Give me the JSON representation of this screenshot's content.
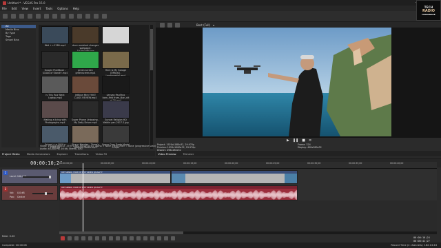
{
  "window": {
    "title": "Untitled * - VEGAS Pro 15.0"
  },
  "menu": [
    "File",
    "Edit",
    "View",
    "Insert",
    "Tools",
    "Options",
    "Help"
  ],
  "logo": {
    "line1": "TECH",
    "line2": "RADIO",
    "line3": "HARDWARE"
  },
  "explorer": {
    "tree": [
      "All",
      "Media Bins",
      "By Type",
      "Tags",
      "Smart Bins"
    ],
    "selected_index": 0,
    "thumbnails": [
      {
        "caption": "8bit + r-1280.mp4",
        "color": "#3a4a5a"
      },
      {
        "caption": "drum ambient changes wallpaper-1920x1080.jpg",
        "color": "#4a3a2a"
      },
      {
        "caption": "",
        "color": "#d6d6d6"
      },
      {
        "caption": "Google PixelBook - $1000 of Stand!!.mp4",
        "color": "#2a2a2a"
      },
      {
        "caption": "green screen greenscreen.mp4",
        "color": "#2fa84a"
      },
      {
        "caption": "Here Is My Garage (Official) - Lamborghini.mp4",
        "color": "#7a6a4a"
      },
      {
        "caption": "Is This Your Next Laptop.mp4",
        "color": "#5a5a5a"
      },
      {
        "caption": "JetBlue Mint FIRST CLASS REVIEW.mp4",
        "color": "#6a4a3a"
      },
      {
        "caption": "Lenyan PaulTrax born_first from_illan_nit of 30.mp4",
        "color": "#1a1a1a"
      },
      {
        "caption": "Making a living with Photographs.mp4",
        "color": "#5a4a4a"
      },
      {
        "caption": "Super Phone Unboxing - My Daily Driver.mp4",
        "color": "#2a2a2a"
      },
      {
        "caption": "Sunset Religion HD Walkie pan-2017-2.jpg",
        "color": "#3a3a4a"
      },
      {
        "caption": "School + a 1920 a 1080.jpg",
        "color": "#4a5a6a"
      },
      {
        "caption": "Shaun Mendes - There's Nothing Holdin.mp4",
        "color": "#7a6a5a"
      },
      {
        "caption": "Space Gray Trade Model S.mp4",
        "color": "#3a3a3a"
      }
    ],
    "info_lines": [
      "Video: 1920x1080x32, 29.970 fps, 00:00:31;01, Alpha = None, Field Order = None (progressive scan)",
      "Audio: 48,000 Hz, 16 bit, Stereo, AAC"
    ],
    "tabs": [
      "Project Media",
      "Media Generators",
      "Explorer",
      "Transitions",
      "Video FX"
    ]
  },
  "preview": {
    "quality": "Best (Full)",
    "stats_left": [
      "Project:  1920x1080x32, 29.970p",
      "Preview:  1920x1080x32, 29.970p",
      "Display:  498x280x32"
    ],
    "stats_right": [
      "Frame:  324",
      "Display:  498x280x32"
    ],
    "tabs": [
      "Video Preview",
      "Trimmer"
    ]
  },
  "timeline": {
    "timecode": "00:00:10;24",
    "ruler_labels": [
      "00:00:00;00",
      "00:00:05;00",
      "00:00:10;00",
      "00:00:15;00",
      "00:00:20;00",
      "00:00:25;00",
      "00:00:30;00",
      "00:00:35;00",
      "00:00:40;00"
    ],
    "video_track": {
      "number": "1",
      "level": "Level: 100.0 %"
    },
    "audio_track": {
      "number": "2",
      "vol_label": "Vol:",
      "vol_value": "0.0 dB",
      "pan_label": "Pan:",
      "pan_value": "Center"
    },
    "clip_label": "ICE SPARK, HOW IS THE VIDEO QUALITY",
    "rate": "Rate: 0.00",
    "right_codes": [
      "00:00:10;24",
      "00:00:41;27"
    ]
  },
  "status": {
    "left": "Complete: 00:00:06",
    "right": "Record Time (2 channels): 162:13:43"
  },
  "colors": {
    "accent": "#3c5a8a",
    "video_track": "#5a5a70",
    "audio_track": "#6a3c3c",
    "audio_clip": "#9b2e3c"
  }
}
